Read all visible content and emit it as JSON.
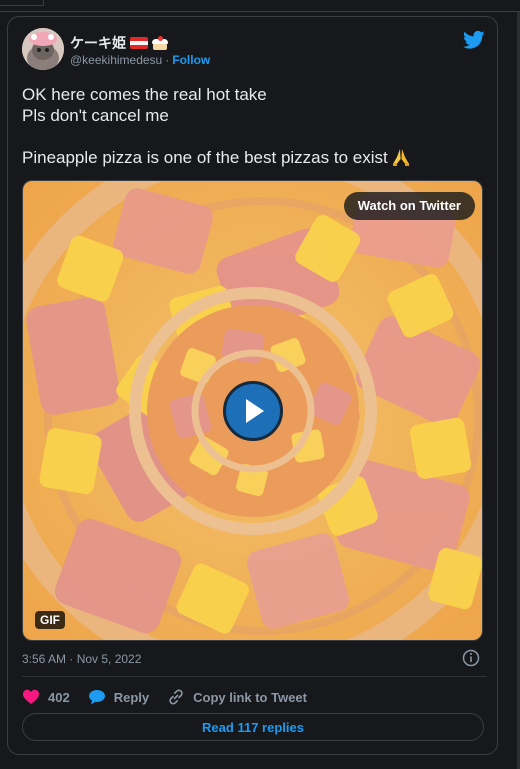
{
  "author": {
    "display_name": "ケーキ姫",
    "handle": "@keekihimedesu",
    "separator": "·",
    "follow_label": "Follow",
    "emoji_icons": [
      "austria-flag-icon",
      "cake-icon"
    ]
  },
  "tweet": {
    "lines": [
      "OK here comes the real hot take",
      "Pls don't cancel me",
      "",
      "Pineapple pizza is one of the best pizzas to exist"
    ],
    "trailing_emoji": "praying-hands-icon"
  },
  "media": {
    "watch_label": "Watch on Twitter",
    "badge": "GIF",
    "play_icon": "play-icon"
  },
  "meta": {
    "timestamp": "3:56 AM · Nov 5, 2022"
  },
  "actions": {
    "like_count": "402",
    "reply_label": "Reply",
    "copy_label": "Copy link to Tweet"
  },
  "footer": {
    "replies_label": "Read 117 replies"
  },
  "colors": {
    "background": "#16181c",
    "accent": "#1d9bf0",
    "like": "#f91880",
    "text": "#e7e9ea",
    "muted": "#8b98a5"
  }
}
